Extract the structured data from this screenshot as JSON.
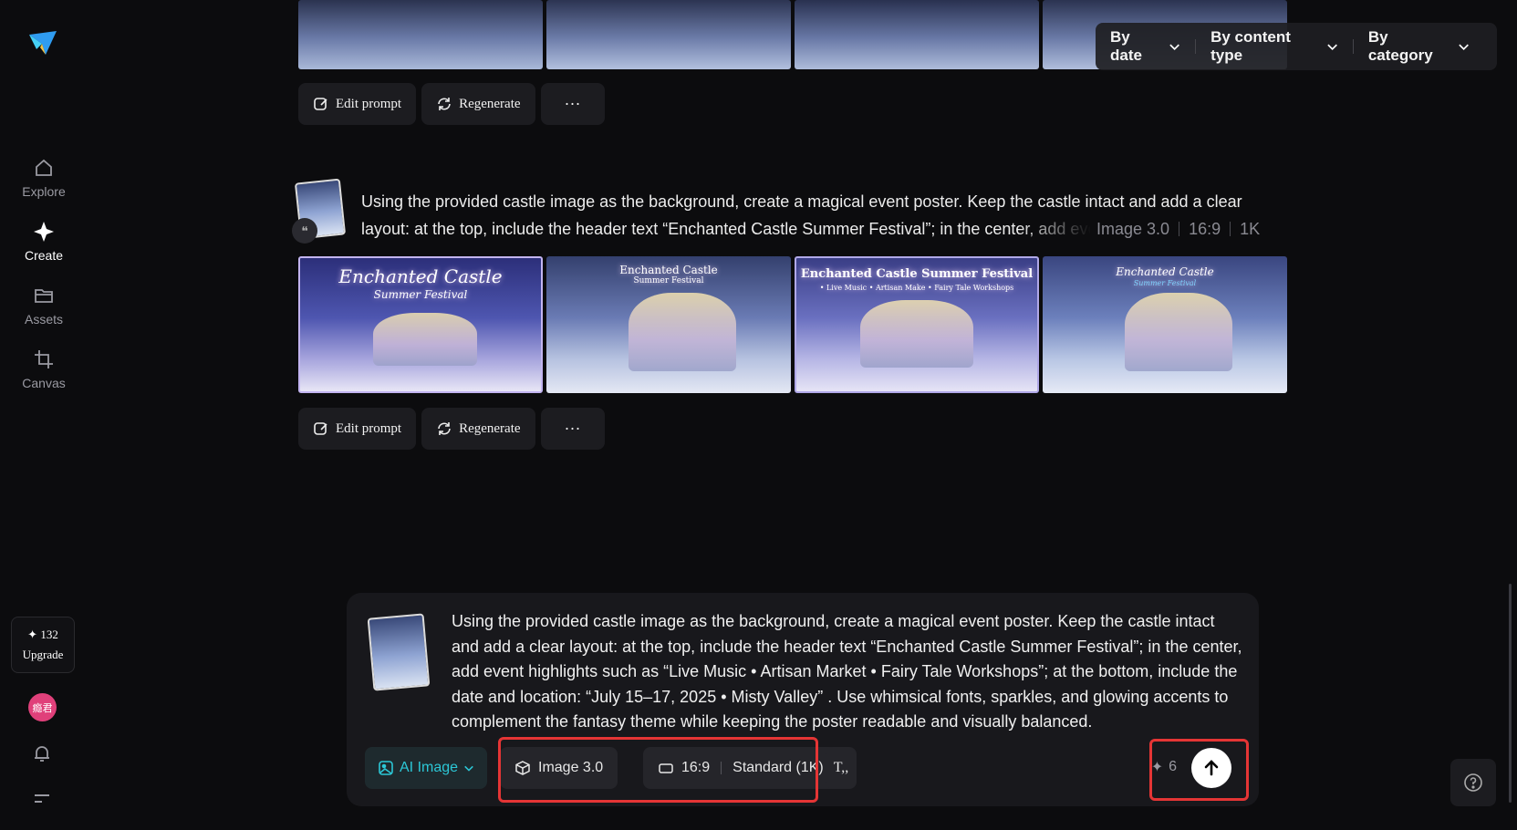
{
  "sidebar": {
    "items": [
      {
        "label": "Explore",
        "icon": "home-icon"
      },
      {
        "label": "Create",
        "icon": "sparkle-icon"
      },
      {
        "label": "Assets",
        "icon": "folder-icon"
      },
      {
        "label": "Canvas",
        "icon": "crop-icon"
      }
    ],
    "credits": "✦ 132",
    "upgrade": "Upgrade",
    "avatar": "瘾君"
  },
  "filters": [
    {
      "label": "By date"
    },
    {
      "label": "By content type"
    },
    {
      "label": "By category"
    }
  ],
  "actions": {
    "edit_prompt": "Edit prompt",
    "regenerate": "Regenerate",
    "more": "···"
  },
  "generation": {
    "prompt_line1": "Using the provided castle image as the background, create a magical event poster. Keep the castle intact and add a clear",
    "prompt_line2": "layout: at the top, include the header text “Enchanted Castle Summer Festival”; in the center, add event highlights",
    "model": "Image 3.0",
    "ratio": "16:9",
    "resolution": "1K",
    "quote_badge": "❝",
    "posters": [
      {
        "title": "Enchanted Castle",
        "subtitle": "Summer Festival"
      },
      {
        "title": "Enchanted Castle",
        "subtitle": "Summer Festival"
      },
      {
        "title": "Enchanted Castle Summer Festival",
        "subtitle": "• Live Music • Artisan Make • Fairy Tale Workshops"
      },
      {
        "title": "Enchanted Castle",
        "subtitle": "Summer Festival"
      }
    ]
  },
  "composer": {
    "text": "Using the provided castle image as the background, create a magical event poster.  Keep the castle intact and add a clear layout: at the top, include the header text “Enchanted Castle Summer Festival”;  in the center, add event highlights such as “Live Music • Artisan Market • Fairy Tale Workshops”;  at the bottom, include the date and location: “July 15–17, 2025 • Misty Valley” .  Use whimsical fonts, sparkles, and glowing accents to complement the fantasy theme while keeping the poster readable and visually balanced.",
    "mode": "AI Image",
    "model": "Image 3.0",
    "ratio": "16:9",
    "quality": "Standard (1K)",
    "text_style_icon": "T,,",
    "cost": "6"
  },
  "colors": {
    "accent": "#2cc7d6",
    "highlight": "#e53535",
    "avatar": "#e0407a"
  }
}
